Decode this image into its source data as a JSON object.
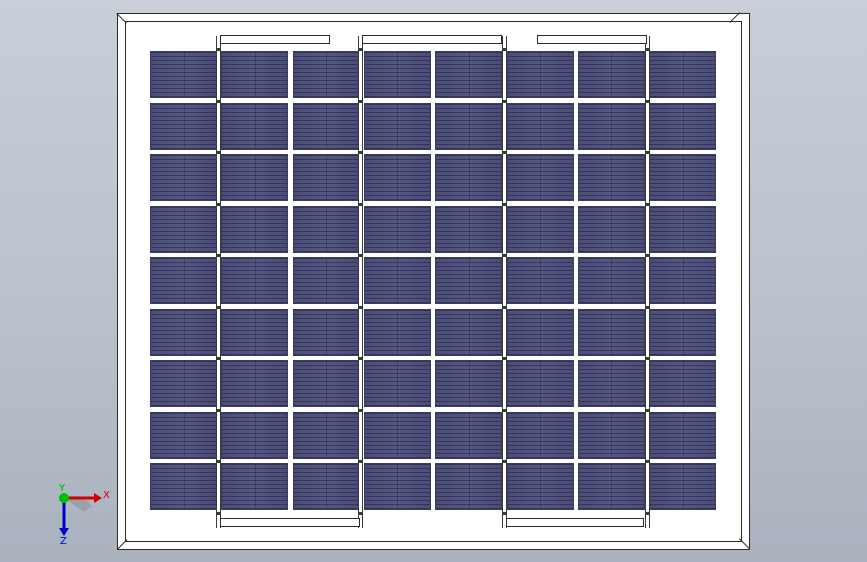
{
  "panel": {
    "rows": 9,
    "columns": 8
  },
  "triad": {
    "x_label": "X",
    "y_label": "Y",
    "z_label": "Z",
    "colors": {
      "x": "#d40000",
      "y": "#00b400",
      "z": "#0000c8",
      "origin": "#00c000"
    }
  },
  "colors": {
    "background_top": "#c9cfd8",
    "background_bottom": "#a9b2be",
    "cell": "#4c4f78",
    "frame": "#ffffff",
    "edge": "#2b2b2b"
  }
}
